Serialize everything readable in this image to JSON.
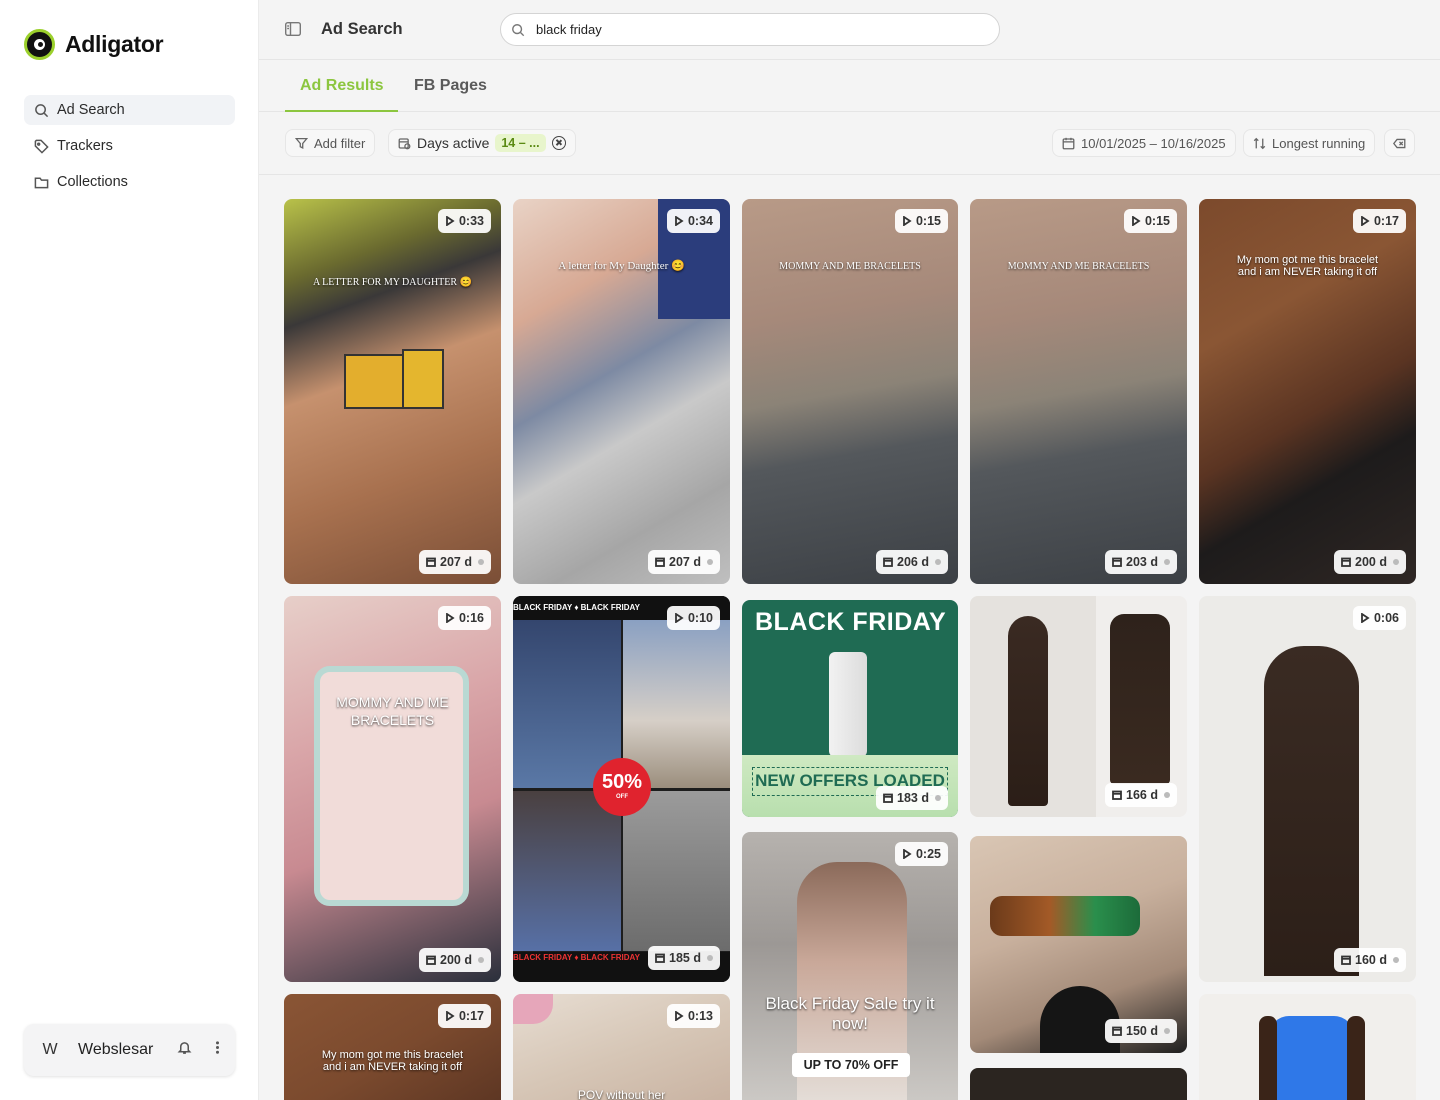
{
  "app": {
    "name": "Adligator"
  },
  "sidebar": {
    "items": [
      {
        "label": "Ad Search",
        "icon": "search-icon"
      },
      {
        "label": "Trackers",
        "icon": "tag-icon"
      },
      {
        "label": "Collections",
        "icon": "folder-icon"
      }
    ],
    "user": {
      "initial": "W",
      "name": "Webslesar"
    }
  },
  "header": {
    "title": "Ad Search",
    "search_value": "black friday"
  },
  "tabs": [
    {
      "label": "Ad Results"
    },
    {
      "label": "FB Pages"
    }
  ],
  "filters": {
    "add_filter": "Add filter",
    "days_active_label": "Days active",
    "days_active_value": "14 – ...",
    "date_range": "10/01/2025 – 10/16/2025",
    "sort": "Longest running"
  },
  "cards": [
    {
      "duration": "0:33",
      "days": "207 d",
      "text": "A LETTER FOR MY DAUGHTER 😊"
    },
    {
      "duration": "0:34",
      "days": "207 d",
      "text": "A letter for My Daughter 😊"
    },
    {
      "duration": "0:15",
      "days": "206 d",
      "text": "MOMMY AND ME BRACELETS"
    },
    {
      "duration": "0:15",
      "days": "203 d",
      "text": "MOMMY AND ME BRACELETS"
    },
    {
      "duration": "0:17",
      "days": "200 d",
      "text": "My mom got me this bracelet and i am NEVER taking it off"
    },
    {
      "duration": "0:16",
      "days": "200 d",
      "text": "MOMMY AND ME BRACELETS"
    },
    {
      "duration": "0:10",
      "days": "185 d",
      "text": "50%",
      "sub": "OFF",
      "banner": "BLACK FRIDAY ♦ BLACK FRIDAY"
    },
    {
      "duration": "",
      "days": "183 d",
      "text": "BLACK FRIDAY",
      "sub": "NEW OFFERS LOADED"
    },
    {
      "duration": "",
      "days": "166 d",
      "text": ""
    },
    {
      "duration": "0:06",
      "days": "160 d",
      "text": ""
    },
    {
      "duration": "0:25",
      "days": "",
      "text": "Black Friday Sale try it now!",
      "sub": "UP TO 70% OFF"
    },
    {
      "duration": "",
      "days": "150 d",
      "text": ""
    },
    {
      "duration": "0:17",
      "days": "",
      "text": "My mom got me this bracelet and i am NEVER taking it off"
    },
    {
      "duration": "0:13",
      "days": "",
      "text": "POV without her"
    }
  ],
  "colors": {
    "accent": "#8cc63f",
    "brand": "#9bd02c"
  }
}
